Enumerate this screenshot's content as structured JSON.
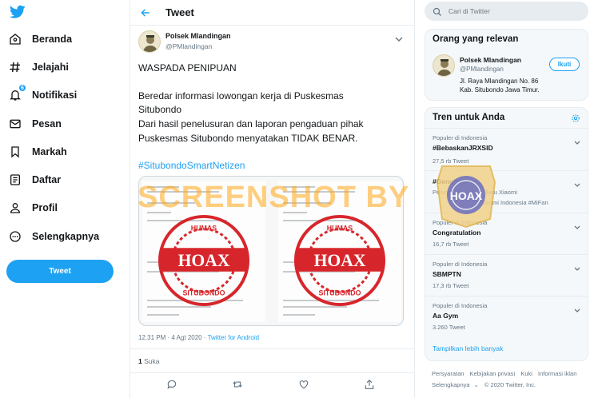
{
  "nav": {
    "items": [
      {
        "label": "Beranda",
        "icon": "home-icon"
      },
      {
        "label": "Jelajahi",
        "icon": "hashtag-icon"
      },
      {
        "label": "Notifikasi",
        "icon": "bell-icon",
        "badge": "6"
      },
      {
        "label": "Pesan",
        "icon": "mail-icon"
      },
      {
        "label": "Markah",
        "icon": "bookmark-icon"
      },
      {
        "label": "Daftar",
        "icon": "list-icon"
      },
      {
        "label": "Profil",
        "icon": "person-icon"
      },
      {
        "label": "Selengkapnya",
        "icon": "more-icon"
      }
    ],
    "tweet_button": "Tweet"
  },
  "header": {
    "title": "Tweet"
  },
  "tweet": {
    "author_name": "Polsek Mlandingan",
    "author_handle": "@PMlandingan",
    "line1": "WASPADA PENIPUAN",
    "line2a": "Beredar informasi lowongan kerja di Puskesmas",
    "line2b": "Situbondo",
    "line3a": "Dari hasil penelusuran dan laporan pengaduan pihak",
    "line3b": "Puskesmas Situbondo menyatakan TIDAK BENAR.",
    "hashtag": "#SitubondoSmartNetizen",
    "stamp_text": "HOAX",
    "stamp_ring_top": "HUMAS",
    "stamp_ring_bottom": "SITUBONDO",
    "time": "12.31 PM · 4 Agt 2020 ·",
    "source": "Twitter for Android",
    "likes_count": "1",
    "likes_label": "Suka"
  },
  "watermark": "SCREENSHOT BY",
  "search": {
    "placeholder": "Cari di Twitter"
  },
  "relevant": {
    "title": "Orang yang relevan",
    "name": "Polsek Mlandingan",
    "handle": "@PMlandingan",
    "bio": "Jl. Raya Mlandingan No. 86 Kab. Situbondo Jawa Timur.",
    "follow": "Ikuti"
  },
  "trends": {
    "title": "Tren untuk Anda",
    "items": [
      {
        "context": "Populer di Indonesia",
        "name": "#BebaskanJRXSID",
        "count": "27,5 rb Tweet"
      },
      {
        "context": "",
        "name": "#Gengjagoan",
        "sub": "Peluncuran Ponsel Baru Xiaomi",
        "sub2": "Xiaomi Indonesia #MiFan"
      },
      {
        "context": "Populer di Indonesia",
        "name": "Congratulation",
        "count": "16,7 rb Tweet"
      },
      {
        "context": "Populer di Indonesia",
        "name": "SBMPTN",
        "count": "17,3 rb Tweet"
      },
      {
        "context": "Populer di Indonesia",
        "name": "Aa Gym",
        "count": "3.260 Tweet"
      }
    ],
    "show_more": "Tampilkan lebih banyak"
  },
  "footer": {
    "links": [
      "Persyaratan",
      "Kebijakan privasi",
      "Kuki",
      "Informasi iklan"
    ],
    "more": "Selengkapnya",
    "copyright": "© 2020 Twitter, Inc."
  },
  "badge_text": "HOAX",
  "colors": {
    "accent": "#1da1f2",
    "stamp": "#d7262b",
    "watermark": "#ffa514"
  }
}
